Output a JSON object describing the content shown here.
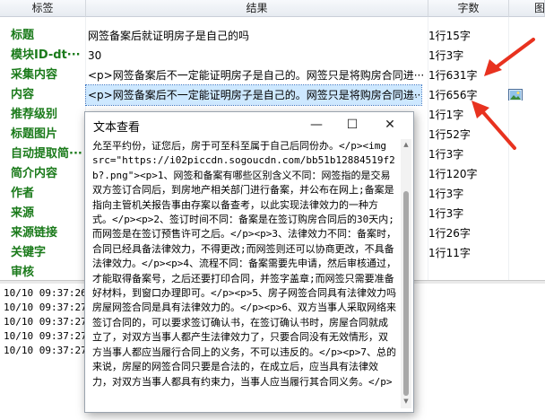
{
  "columns": {
    "label": "标签",
    "result": "结果",
    "count": "字数",
    "extra": "图"
  },
  "rows": [
    {
      "label": "标题",
      "result": "网签备案后就证明房子是自己的吗",
      "count": "1行15字"
    },
    {
      "label": "模块ID-dt···",
      "result": "30",
      "count": "1行3字"
    },
    {
      "label": "采集内容",
      "result": "<p>网签备案后不一定能证明房子是自己的。网签只是将购房合同进···",
      "count": "1行631字"
    },
    {
      "label": "内容",
      "result": "<p>网签备案后不一定能证明房子是自己的。网签只是将购房合同进···",
      "count": "1行656字",
      "ellipsis": "···",
      "selected": true
    },
    {
      "label": "推荐级别",
      "result": "",
      "count": "1行1字"
    },
    {
      "label": "标题图片",
      "result": "",
      "count": "1行52字"
    },
    {
      "label": "自动提取简···",
      "result": "",
      "count": "1行3字"
    },
    {
      "label": "简介内容",
      "result": "",
      "count": "1行120字"
    },
    {
      "label": "作者",
      "result": "",
      "count": "1行3字"
    },
    {
      "label": "来源",
      "result": "",
      "count": "1行3字"
    },
    {
      "label": "来源链接",
      "result": "",
      "count": "1行26字"
    },
    {
      "label": "关键字",
      "result": "",
      "count": "1行11字"
    },
    {
      "label": "审核",
      "result": "",
      "count": ""
    }
  ],
  "log": [
    "10/10 09:37:26",
    "10/10 09:37:27",
    "10/10 09:37:27",
    "10/10 09:37:27",
    "10/10 09:37:27"
  ],
  "dialog": {
    "title": "文本查看",
    "minimize": "—",
    "maximize": "☐",
    "close": "✕",
    "text": "允至平约份，证您后，房于可至科至属于自己后同份办。</p><img src=\"https://i02piccdn.sogoucdn.com/bb51b12884519f2b?.png\"><p>1、网签和备案有哪些区别含义不同：网签指的是交易双方签订合同后，到房地产相关部门进行备案，并公布在网上;备案是指向主管机关报告事由存案以备查考，以此实现法律效力的一种方式。</p><p>2、签订时间不同：备案是在签订购房合同后的30天内;而网签是在签订预售许可之后。</p><p>3、法律效力不同：备案时，合同已经具备法律效力，不得更改;而网签则还可以协商更改，不具备法律效力。</p><p>4、流程不同：备案需要先申请，然后审核通过，才能取得备案号，之后还要打印合同，并签字盖章;而网签只需要准备好材料，到窗口办理即可。</p><p>5、房子网签合同具有法律效力吗房屋网签合同是具有法律效力的。</p><p>6、双方当事人采取网络来签订合同的，可以要求签订确认书，在签订确认书时，房屋合同就成立了，对双方当事人都产生法律效力了，只要合同没有无效情形，双方当事人都应当履行合同上的义务，不可以违反的。</p><p>7、总的来说，房屋的网签合同只要是合法的，在成立后，应当具有法律效力，对双方当事人都具有约束力，当事人应当履行其合同义务。</p>"
  },
  "colors": {
    "label_green": "#1a7a1a",
    "arrow_red": "#e8321f",
    "selection": "#cde8ff"
  }
}
